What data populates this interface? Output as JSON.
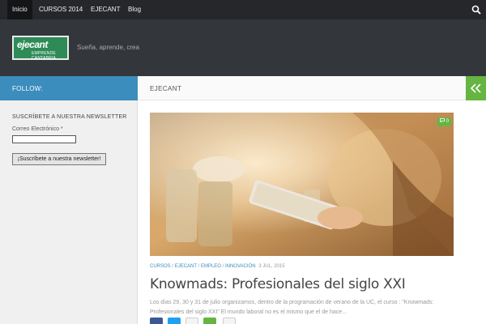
{
  "nav": {
    "items": [
      "Inicio",
      "CURSOS 2014",
      "EJECANT",
      "Blog"
    ],
    "search_icon": "search-icon"
  },
  "header": {
    "logo_text": "ejecant",
    "logo_sub": "EMPRENDE CANTABRIA",
    "tagline": "Sueña, aprende, crea"
  },
  "sidebar": {
    "follow_label": "FOLLOW:",
    "newsletter_title": "SUSCRÍBETE A NUESTRA NEWSLETTER",
    "email_label": "Correo Electrónico *",
    "email_value": "",
    "subscribe_label": "¡Suscríbete a nuestra newsletter!"
  },
  "content": {
    "section_title": "EJECANT",
    "collapse_icon": "double-chevron-left-icon"
  },
  "post": {
    "comment_count": "0",
    "categories": [
      "CURSOS",
      "EJECANT",
      "EMPLEO",
      "INNOVACIÓN"
    ],
    "separator": " / ",
    "date": "3 JUL, 2015",
    "title": "Knowmads: Profesionales del siglo XXI",
    "excerpt": "Los días 29, 30 y 31 de julio organizamos, dentro de la programación de verano de la UC, el curso : \"Knowmads: Profesionales del siglo XXI\" El mundo laboral no es el mismo que el de hace…",
    "share_icons": [
      "facebook-icon",
      "twitter-icon",
      "email-icon",
      "share-icon",
      "google-plus-icon"
    ]
  },
  "colors": {
    "accent_blue": "#3b8dbd",
    "accent_green": "#66b543",
    "nav_bg": "#26272b",
    "header_bg": "#33363b"
  }
}
